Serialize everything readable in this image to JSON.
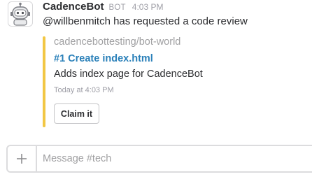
{
  "message": {
    "bot_name": "CadenceBot",
    "badge": "BOT",
    "time": "4:03 PM",
    "text": "@willbenmitch has requested a code review",
    "avatar_icon": "robot-avatar-icon"
  },
  "attachment": {
    "accent_color": "#f2c744",
    "repo": "cadencebottesting/bot-world",
    "title": "#1 Create index.html",
    "description": "Adds index page for CadenceBot",
    "timestamp": "Today at 4:03 PM",
    "action_label": "Claim it"
  },
  "composer": {
    "placeholder": "Message #tech",
    "value": "",
    "attach_icon": "plus-icon"
  }
}
